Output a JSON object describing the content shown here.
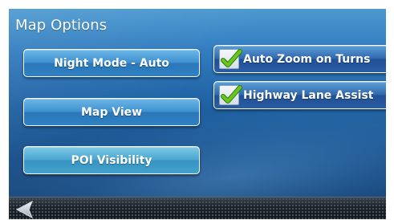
{
  "header": {
    "title": "Map Options"
  },
  "buttons": {
    "night_mode": "Night Mode - Auto",
    "map_view": "Map View",
    "poi_visibility": "POI Visibility"
  },
  "toggles": [
    {
      "label": "Auto Zoom on Turns",
      "checked": true
    },
    {
      "label": "Highway Lane Assist",
      "checked": true
    }
  ],
  "footer": {
    "back_icon": "back-arrow-icon"
  },
  "colors": {
    "background_top": "#4b9ad1",
    "background_bottom": "#103b6d",
    "button_light": "#3d90cf",
    "button_dark": "#204f94",
    "checkmark": "#69c61c",
    "footer": "#1f252b"
  },
  "icons": {
    "checkbox": "checkmark-icon"
  }
}
